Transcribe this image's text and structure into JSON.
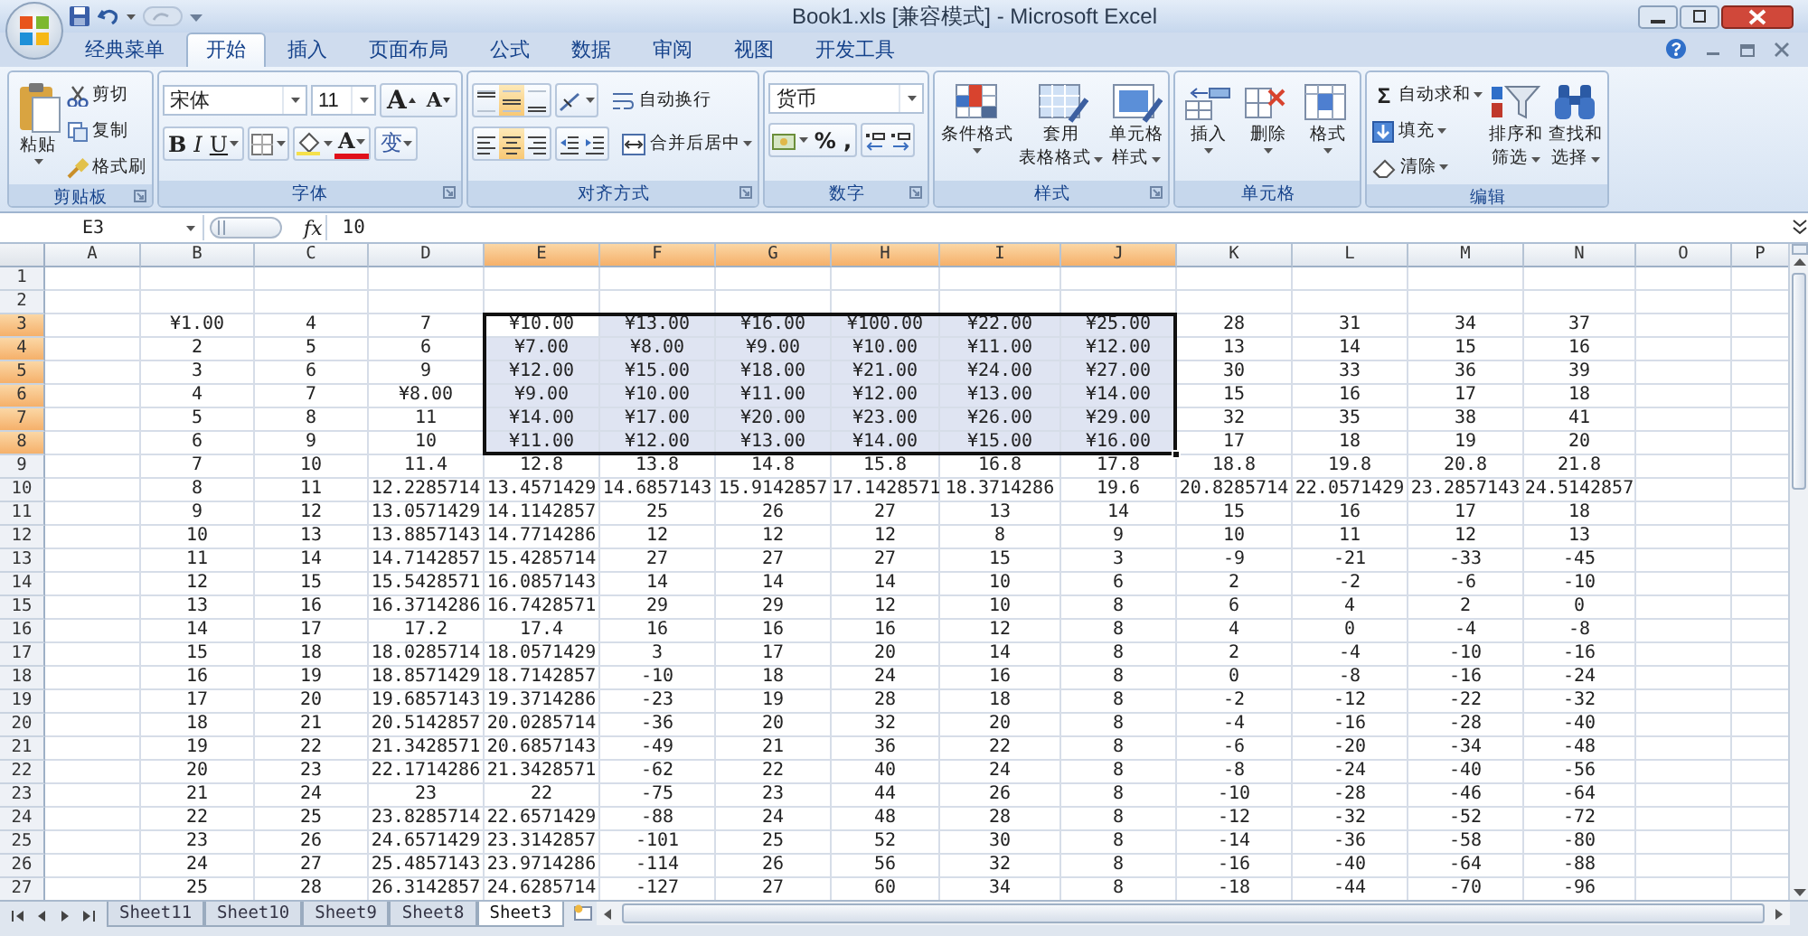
{
  "window": {
    "title": "Book1.xls  [兼容模式] - Microsoft Excel"
  },
  "ribbon_tabs": [
    {
      "label": "经典菜单",
      "selected": false
    },
    {
      "label": "开始",
      "selected": true
    },
    {
      "label": "插入",
      "selected": false
    },
    {
      "label": "页面布局",
      "selected": false
    },
    {
      "label": "公式",
      "selected": false
    },
    {
      "label": "数据",
      "selected": false
    },
    {
      "label": "审阅",
      "selected": false
    },
    {
      "label": "视图",
      "selected": false
    },
    {
      "label": "开发工具",
      "selected": false
    }
  ],
  "ribbon_groups": [
    {
      "kind": "clipboard",
      "label": "剪贴板",
      "launcher": true,
      "paste": "粘贴",
      "items": [
        "剪切",
        "复制",
        "格式刷"
      ]
    },
    {
      "kind": "font",
      "label": "字体",
      "launcher": true,
      "font_name": "宋体",
      "font_size": "11",
      "grow": "A",
      "shrink": "A",
      "style_buttons": [
        "B",
        "I",
        "U"
      ],
      "font_color": "A",
      "phonetic": "变"
    },
    {
      "kind": "alignment",
      "label": "对齐方式",
      "launcher": true,
      "vertical": [
        {
          "selected": false
        },
        {
          "selected": true
        },
        {
          "selected": false
        }
      ],
      "horizontal": [
        {
          "selected": false
        },
        {
          "selected": true
        },
        {
          "selected": false
        }
      ],
      "wrap": "自动换行",
      "merge": "合并后居中"
    },
    {
      "kind": "number",
      "label": "数字",
      "launcher": true,
      "format": "货币",
      "buttons": [
        "%",
        ","
      ]
    },
    {
      "kind": "styles",
      "label": "样式",
      "launcher": true,
      "buttons": [
        {
          "lines": [
            "条件格式"
          ]
        },
        {
          "lines": [
            "套用",
            "表格格式"
          ]
        },
        {
          "lines": [
            "单元格",
            "样式"
          ]
        }
      ]
    },
    {
      "kind": "cells",
      "label": "单元格",
      "launcher": false,
      "buttons": [
        {
          "lines": [
            "插入"
          ]
        },
        {
          "lines": [
            "删除"
          ]
        },
        {
          "lines": [
            "格式"
          ]
        }
      ]
    },
    {
      "kind": "editing",
      "label": "编辑",
      "launcher": false,
      "sum_sign": "Σ",
      "small": [
        "自动求和",
        "填充",
        "清除"
      ],
      "large": [
        {
          "lines": [
            "排序和",
            "筛选"
          ]
        },
        {
          "lines": [
            "查找和",
            "选择"
          ]
        }
      ]
    }
  ],
  "formula_bar": {
    "name_box": "E3",
    "fx": "fx",
    "value": "10"
  },
  "columns": [
    {
      "label": "A",
      "selected": false
    },
    {
      "label": "B",
      "selected": false
    },
    {
      "label": "C",
      "selected": false
    },
    {
      "label": "D",
      "selected": false
    },
    {
      "label": "E",
      "selected": true
    },
    {
      "label": "F",
      "selected": true
    },
    {
      "label": "G",
      "selected": true
    },
    {
      "label": "H",
      "selected": true
    },
    {
      "label": "I",
      "selected": true
    },
    {
      "label": "J",
      "selected": true
    },
    {
      "label": "K",
      "selected": false
    },
    {
      "label": "L",
      "selected": false
    },
    {
      "label": "M",
      "selected": false
    },
    {
      "label": "N",
      "selected": false
    },
    {
      "label": "O",
      "selected": false
    },
    {
      "label": "P",
      "selected": false
    }
  ],
  "rows": [
    {
      "label": "1",
      "selected": false
    },
    {
      "label": "2",
      "selected": false
    },
    {
      "label": "3",
      "selected": true,
      "cells": [
        "¥1.00",
        "4",
        "7",
        "¥10.00",
        "¥13.00",
        "¥16.00",
        "¥100.00",
        "¥22.00",
        "¥25.00",
        "28",
        "31",
        "34",
        "37"
      ]
    },
    {
      "label": "4",
      "selected": true,
      "cells": [
        "2",
        "5",
        "6",
        "¥7.00",
        "¥8.00",
        "¥9.00",
        "¥10.00",
        "¥11.00",
        "¥12.00",
        "13",
        "14",
        "15",
        "16"
      ]
    },
    {
      "label": "5",
      "selected": true,
      "cells": [
        "3",
        "6",
        "9",
        "¥12.00",
        "¥15.00",
        "¥18.00",
        "¥21.00",
        "¥24.00",
        "¥27.00",
        "30",
        "33",
        "36",
        "39"
      ]
    },
    {
      "label": "6",
      "selected": true,
      "cells": [
        "4",
        "7",
        "¥8.00",
        "¥9.00",
        "¥10.00",
        "¥11.00",
        "¥12.00",
        "¥13.00",
        "¥14.00",
        "15",
        "16",
        "17",
        "18"
      ]
    },
    {
      "label": "7",
      "selected": true,
      "cells": [
        "5",
        "8",
        "11",
        "¥14.00",
        "¥17.00",
        "¥20.00",
        "¥23.00",
        "¥26.00",
        "¥29.00",
        "32",
        "35",
        "38",
        "41"
      ]
    },
    {
      "label": "8",
      "selected": true,
      "cells": [
        "6",
        "9",
        "10",
        "¥11.00",
        "¥12.00",
        "¥13.00",
        "¥14.00",
        "¥15.00",
        "¥16.00",
        "17",
        "18",
        "19",
        "20"
      ]
    },
    {
      "label": "9",
      "selected": false,
      "cells": [
        "7",
        "10",
        "11.4",
        "12.8",
        "13.8",
        "14.8",
        "15.8",
        "16.8",
        "17.8",
        "18.8",
        "19.8",
        "20.8",
        "21.8"
      ]
    },
    {
      "label": "10",
      "selected": false,
      "cells": [
        "8",
        "11",
        "12.2285714",
        "13.4571429",
        "14.6857143",
        "15.9142857",
        "17.1428571",
        "18.3714286",
        "19.6",
        "20.8285714",
        "22.0571429",
        "23.2857143",
        "24.5142857"
      ]
    },
    {
      "label": "11",
      "selected": false,
      "cells": [
        "9",
        "12",
        "13.0571429",
        "14.1142857",
        "25",
        "26",
        "27",
        "13",
        "14",
        "15",
        "16",
        "17",
        "18"
      ]
    },
    {
      "label": "12",
      "selected": false,
      "cells": [
        "10",
        "13",
        "13.8857143",
        "14.7714286",
        "12",
        "12",
        "12",
        "8",
        "9",
        "10",
        "11",
        "12",
        "13"
      ]
    },
    {
      "label": "13",
      "selected": false,
      "cells": [
        "11",
        "14",
        "14.7142857",
        "15.4285714",
        "27",
        "27",
        "27",
        "15",
        "3",
        "-9",
        "-21",
        "-33",
        "-45"
      ]
    },
    {
      "label": "14",
      "selected": false,
      "cells": [
        "12",
        "15",
        "15.5428571",
        "16.0857143",
        "14",
        "14",
        "14",
        "10",
        "6",
        "2",
        "-2",
        "-6",
        "-10"
      ]
    },
    {
      "label": "15",
      "selected": false,
      "cells": [
        "13",
        "16",
        "16.3714286",
        "16.7428571",
        "29",
        "29",
        "12",
        "10",
        "8",
        "6",
        "4",
        "2",
        "0"
      ]
    },
    {
      "label": "16",
      "selected": false,
      "cells": [
        "14",
        "17",
        "17.2",
        "17.4",
        "16",
        "16",
        "16",
        "12",
        "8",
        "4",
        "0",
        "-4",
        "-8"
      ]
    },
    {
      "label": "17",
      "selected": false,
      "cells": [
        "15",
        "18",
        "18.0285714",
        "18.0571429",
        "3",
        "17",
        "20",
        "14",
        "8",
        "2",
        "-4",
        "-10",
        "-16"
      ]
    },
    {
      "label": "18",
      "selected": false,
      "cells": [
        "16",
        "19",
        "18.8571429",
        "18.7142857",
        "-10",
        "18",
        "24",
        "16",
        "8",
        "0",
        "-8",
        "-16",
        "-24"
      ]
    },
    {
      "label": "19",
      "selected": false,
      "cells": [
        "17",
        "20",
        "19.6857143",
        "19.3714286",
        "-23",
        "19",
        "28",
        "18",
        "8",
        "-2",
        "-12",
        "-22",
        "-32"
      ]
    },
    {
      "label": "20",
      "selected": false,
      "cells": [
        "18",
        "21",
        "20.5142857",
        "20.0285714",
        "-36",
        "20",
        "32",
        "20",
        "8",
        "-4",
        "-16",
        "-28",
        "-40"
      ]
    },
    {
      "label": "21",
      "selected": false,
      "cells": [
        "19",
        "22",
        "21.3428571",
        "20.6857143",
        "-49",
        "21",
        "36",
        "22",
        "8",
        "-6",
        "-20",
        "-34",
        "-48"
      ]
    },
    {
      "label": "22",
      "selected": false,
      "cells": [
        "20",
        "23",
        "22.1714286",
        "21.3428571",
        "-62",
        "22",
        "40",
        "24",
        "8",
        "-8",
        "-24",
        "-40",
        "-56"
      ]
    },
    {
      "label": "23",
      "selected": false,
      "cells": [
        "21",
        "24",
        "23",
        "22",
        "-75",
        "23",
        "44",
        "26",
        "8",
        "-10",
        "-28",
        "-46",
        "-64"
      ]
    },
    {
      "label": "24",
      "selected": false,
      "cells": [
        "22",
        "25",
        "23.8285714",
        "22.6571429",
        "-88",
        "24",
        "48",
        "28",
        "8",
        "-12",
        "-32",
        "-52",
        "-72"
      ]
    },
    {
      "label": "25",
      "selected": false,
      "cells": [
        "23",
        "26",
        "24.6571429",
        "23.3142857",
        "-101",
        "25",
        "52",
        "30",
        "8",
        "-14",
        "-36",
        "-58",
        "-80"
      ]
    },
    {
      "label": "26",
      "selected": false,
      "cells": [
        "24",
        "27",
        "25.4857143",
        "23.9714286",
        "-114",
        "26",
        "56",
        "32",
        "8",
        "-16",
        "-40",
        "-64",
        "-88"
      ]
    },
    {
      "label": "27",
      "selected": false,
      "cells": [
        "25",
        "28",
        "26.3142857",
        "24.6285714",
        "-127",
        "27",
        "60",
        "34",
        "8",
        "-18",
        "-44",
        "-70",
        "-96"
      ]
    }
  ],
  "sheet_tabs": [
    {
      "label": "Sheet11",
      "selected": false
    },
    {
      "label": "Sheet10",
      "selected": false
    },
    {
      "label": "Sheet9",
      "selected": false
    },
    {
      "label": "Sheet8",
      "selected": false
    },
    {
      "label": "Sheet3",
      "selected": true
    }
  ]
}
